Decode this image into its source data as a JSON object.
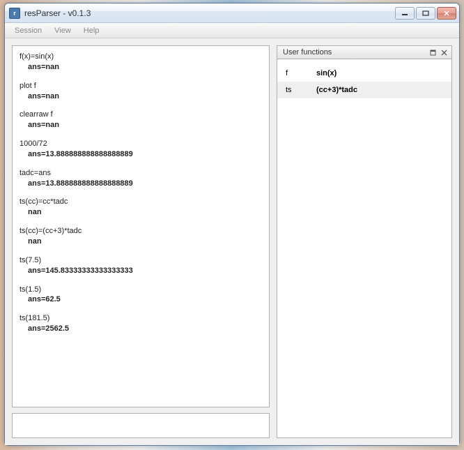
{
  "window": {
    "title": "resParser - v0.1.3"
  },
  "menu": {
    "session": "Session",
    "view": "View",
    "help": "Help"
  },
  "console": {
    "entries": [
      {
        "cmd": "f(x)=sin(x)",
        "result": "ans=nan"
      },
      {
        "cmd": "plot f",
        "result": "ans=nan"
      },
      {
        "cmd": "clearraw f",
        "result": "ans=nan"
      },
      {
        "cmd": "1000/72",
        "result": "ans=13.888888888888888889"
      },
      {
        "cmd": "tadc=ans",
        "result": "ans=13.888888888888888889"
      },
      {
        "cmd": "ts(cc)=cc*tadc",
        "result": "nan"
      },
      {
        "cmd": "ts(cc)=(cc+3)*tadc",
        "result": "nan"
      },
      {
        "cmd": "ts(7.5)",
        "result": "ans=145.83333333333333333"
      },
      {
        "cmd": "ts(1.5)",
        "result": "ans=62.5"
      },
      {
        "cmd": "ts(181.5)",
        "result": "ans=2562.5"
      }
    ],
    "input_value": ""
  },
  "user_functions": {
    "title": "User functions",
    "items": [
      {
        "name": "f",
        "def": "sin(x)"
      },
      {
        "name": "ts",
        "def": "(cc+3)*tadc"
      }
    ]
  }
}
